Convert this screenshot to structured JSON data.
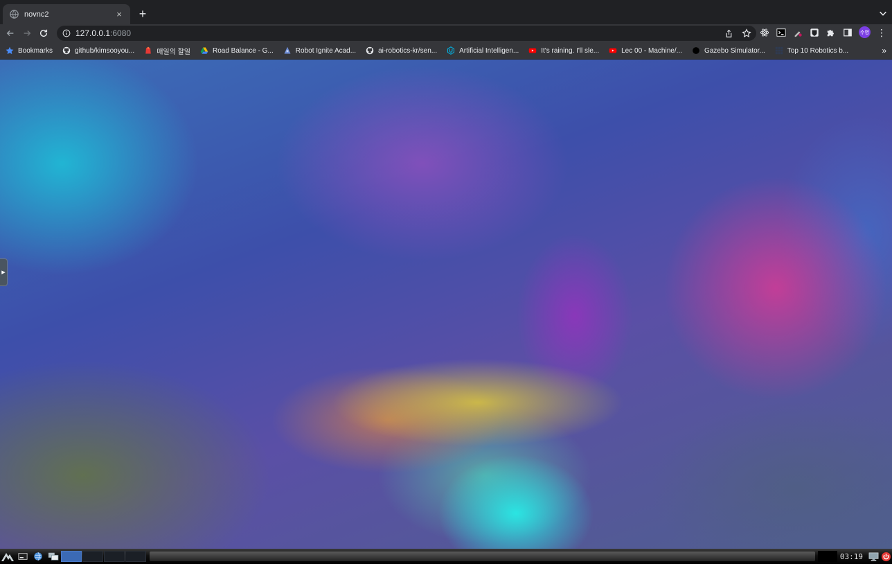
{
  "tab": {
    "title": "novnc2",
    "close_glyph": "×",
    "new_tab_glyph": "+"
  },
  "toolbar": {
    "url_host": "127.0.0.1",
    "url_port": ":6080",
    "avatar_text": "수영",
    "menu_glyph": "⋮"
  },
  "bookmarks": {
    "items": [
      {
        "label": "Bookmarks",
        "icon": "star-icon"
      },
      {
        "label": "github/kimsooyou...",
        "icon": "github-icon"
      },
      {
        "label": "매일의 할일",
        "icon": "red-app-icon"
      },
      {
        "label": "Road Balance - G...",
        "icon": "google-drive-icon"
      },
      {
        "label": "Robot Ignite Acad...",
        "icon": "robot-icon"
      },
      {
        "label": "ai-robotics-kr/sen...",
        "icon": "github-icon"
      },
      {
        "label": "Artificial Intelligen...",
        "icon": "udacity-icon"
      },
      {
        "label": "It's raining. I'll sle...",
        "icon": "youtube-icon"
      },
      {
        "label": "Lec 00 - Machine/...",
        "icon": "youtube-icon"
      },
      {
        "label": "Gazebo Simulator...",
        "icon": "gazebo-icon"
      },
      {
        "label": "Top 10 Robotics b...",
        "icon": "grid-icon"
      }
    ],
    "more_glyph": "»"
  },
  "taskbar": {
    "clock": "03:19"
  },
  "colors": {
    "chrome_dark": "#202124",
    "chrome_toolbar": "#35363a",
    "workspace_active": "#3b6ab5",
    "power_red": "#e53935"
  }
}
